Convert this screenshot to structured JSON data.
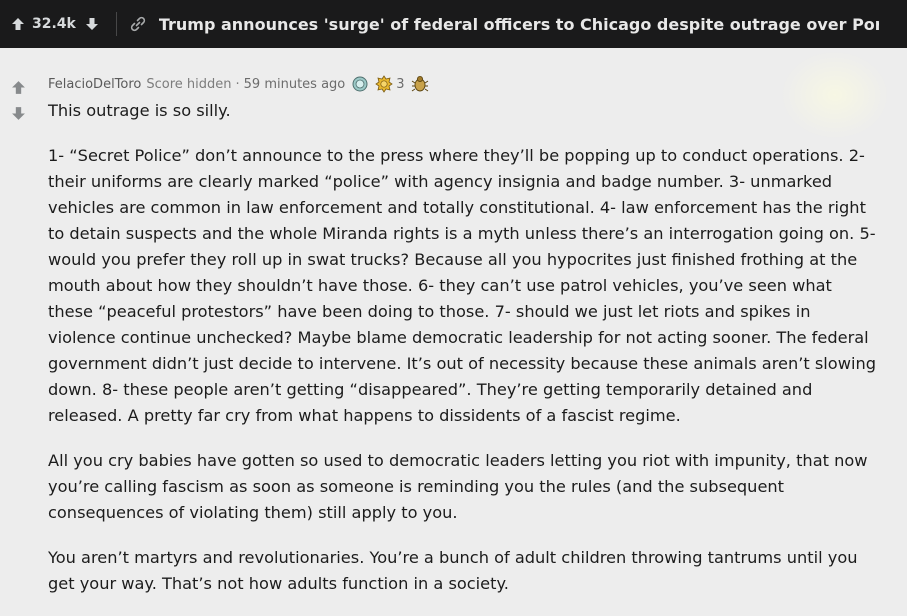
{
  "topbar": {
    "score": "32.4k",
    "post_title": "Trump announces 'surge' of federal officers to Chicago despite outrage over Portland crack..."
  },
  "comment": {
    "author": "FelacioDelToro",
    "score": "Score hidden",
    "separator": "·",
    "time": "59 minutes ago",
    "award_count": "3",
    "paragraphs": [
      "This outrage is so silly.",
      "1- “Secret Police” don’t announce to the press where they’ll be popping up to conduct operations. 2- their uniforms are clearly marked “police” with agency insignia and badge number. 3- unmarked vehicles are common in law enforcement and totally constitutional. 4- law enforcement has the right to detain suspects and the whole Miranda rights is a myth unless there’s an interrogation going on. 5- would you prefer they roll up in swat trucks? Because all you hypocrites just finished frothing at the mouth about how they shouldn’t have those. 6- they can’t use patrol vehicles, you’ve seen what these “peaceful protestors” have been doing to those. 7- should we just let riots and spikes in violence continue unchecked? Maybe blame democratic leadership for not acting sooner. The federal government didn’t just decide to intervene. It’s out of necessity because these animals aren’t slowing down. 8- these people aren’t getting “disappeared”. They’re getting temporarily detained and released. A pretty far cry from what happens to dissidents of a fascist regime.",
      "All you cry babies have gotten so used to democratic leaders letting you riot with impunity, that now you’re calling fascism as soon as someone is reminding you the rules (and the subsequent consequences of violating them) still apply to you.",
      "You aren’t martyrs and revolutionaries. You’re a bunch of adult children throwing tantrums until you get your way. That’s not how adults function in a society."
    ]
  },
  "icons": {
    "topbar_upvote": "arrow-up-icon",
    "topbar_downvote": "arrow-down-icon",
    "link": "link-icon",
    "comment_upvote": "arrow-up-icon",
    "comment_downvote": "arrow-down-icon",
    "award_1": "silver-award-icon",
    "award_2": "gold-award-icon",
    "award_3": "bug-award-icon"
  },
  "colors": {
    "topbar_bg": "#1a1a1b",
    "page_bg": "#ededed",
    "text": "#1c1c1c",
    "meta_text": "#6c6c6c"
  }
}
